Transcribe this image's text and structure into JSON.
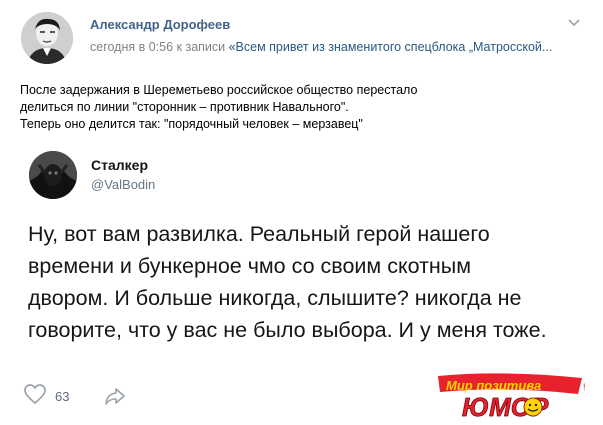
{
  "post": {
    "author": "Александр Дорофеев",
    "meta_prefix": "сегодня в 0:56 к записи ",
    "meta_link": "«Всем привет из знаменитого спецблока „Матросской...",
    "lines": [
      "После задержания в Шереметьево российское общество перестало",
      "делиться по линии \"сторонник – противник Навального\".",
      "Теперь оно делится так: \"порядочный человек – мерзавец\""
    ]
  },
  "tweet": {
    "name": "Сталкер",
    "handle": "@ValBodin",
    "lines": [
      "Ну, вот вам развилка. Реальный герой нашего",
      "времени и бункерное чмо со своим скотным",
      "двором. И больше никогда, слышите? никогда не",
      "говорите, что у вас не было выбора. И у меня тоже."
    ]
  },
  "footer": {
    "likes": "63"
  },
  "watermark": {
    "top_text": "Мир позитива",
    "bottom_text": "ЮМОР"
  },
  "icons": [
    "more-icon",
    "heart-icon",
    "share-icon"
  ],
  "colors": {
    "author_link": "#42648b",
    "meta_link": "#2a5885",
    "meta_gray": "#828282",
    "watermark_red": "#e8212e",
    "watermark_yellow": "#ffd400"
  }
}
